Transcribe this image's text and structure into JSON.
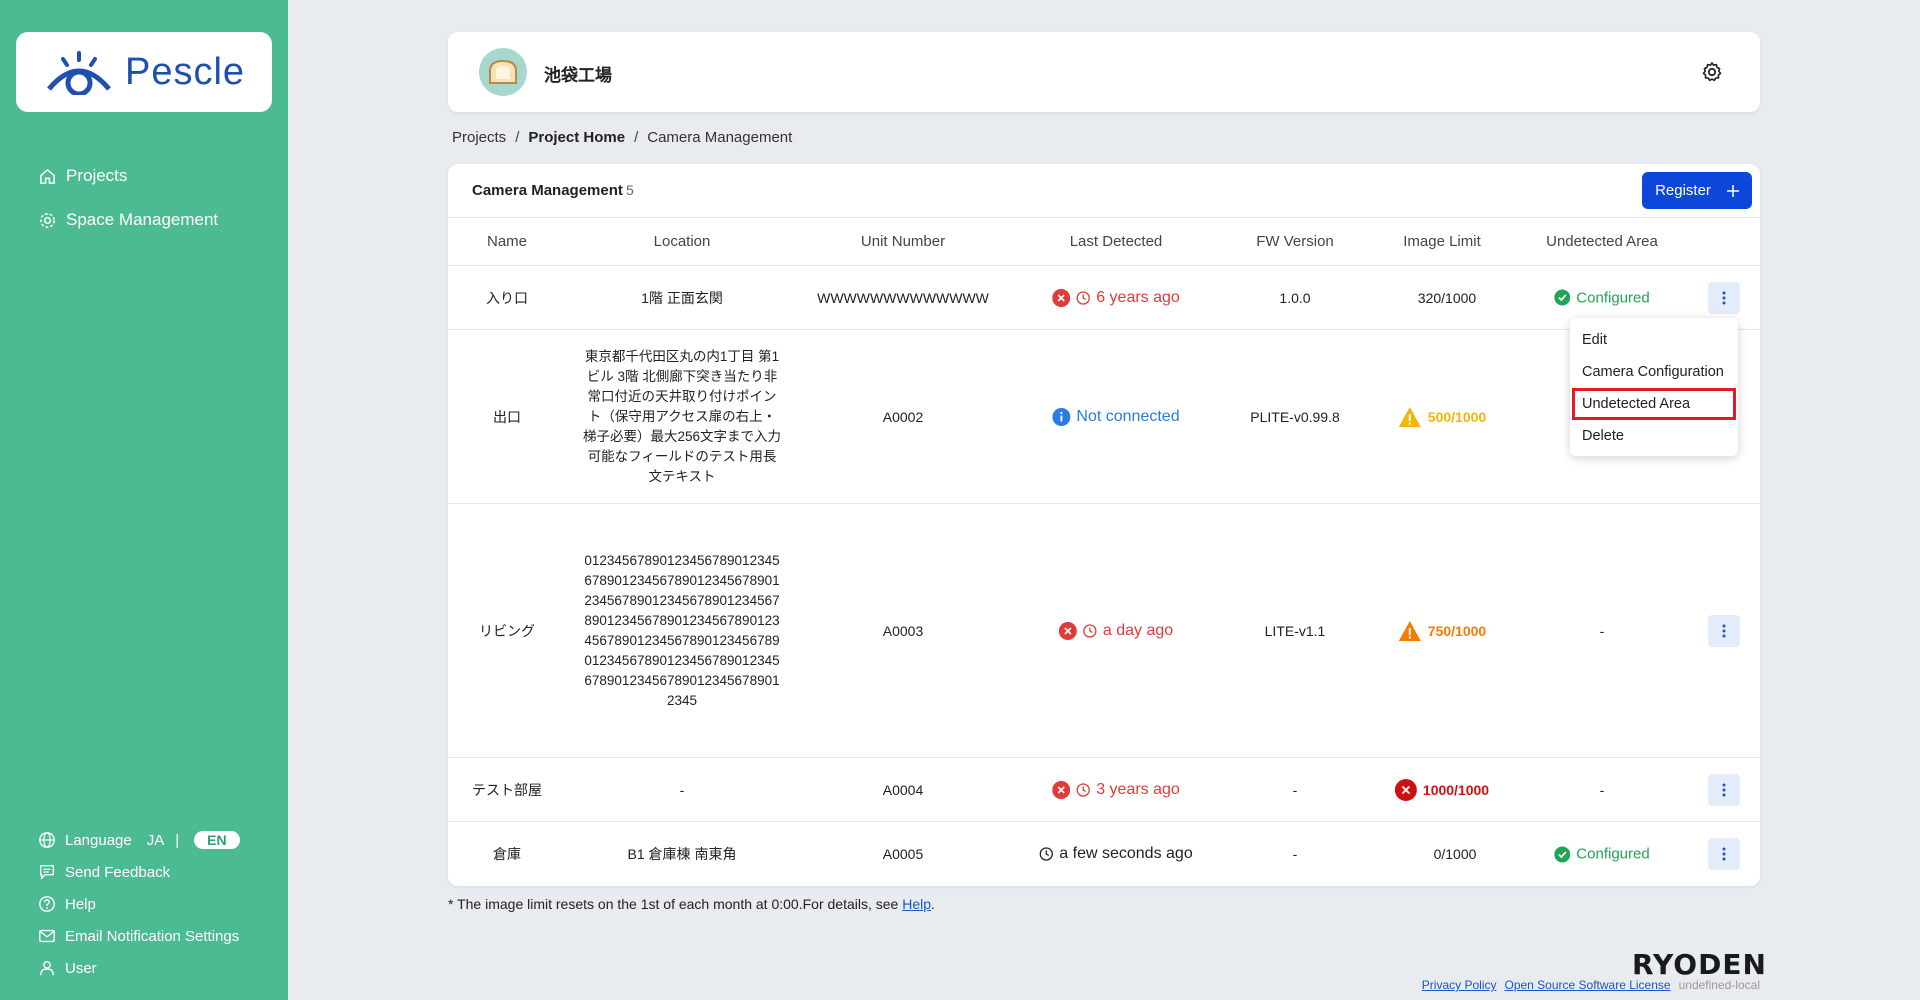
{
  "brand": {
    "logo_text": "Pescle",
    "company": "RYODEN"
  },
  "sidebar": {
    "nav": [
      {
        "label": "Projects",
        "icon": "home-icon"
      },
      {
        "label": "Space Management",
        "icon": "gear-icon"
      }
    ],
    "language": {
      "label": "Language",
      "ja": "JA",
      "separator": "|",
      "en": "EN",
      "selected": "EN"
    },
    "bottom": [
      {
        "label": "Send Feedback",
        "icon": "feedback-icon"
      },
      {
        "label": "Help",
        "icon": "help-icon"
      },
      {
        "label": "Email Notification Settings",
        "icon": "mail-icon"
      },
      {
        "label": "User",
        "icon": "user-icon"
      }
    ]
  },
  "header": {
    "project_name": "池袋工場"
  },
  "breadcrumb": {
    "items": [
      "Projects",
      "Project Home",
      "Camera Management"
    ],
    "separator": "/"
  },
  "card": {
    "title": "Camera Management",
    "count": "5",
    "register_label": "Register"
  },
  "columns": [
    "Name",
    "Location",
    "Unit Number",
    "Last Detected",
    "FW Version",
    "Image Limit",
    "Undetected Area"
  ],
  "rows": [
    {
      "name": "入り口",
      "location": "1階 正面玄関",
      "unit": "WWWWWWWWWWWWW",
      "last_detected": "6 years ago",
      "fw": "1.0.0",
      "limit": "320/1000",
      "undetected": "Configured"
    },
    {
      "name": "出口",
      "location": "東京都千代田区丸の内1丁目 第1ビル 3階 北側廊下突き当たり非常口付近の天井取り付けポイント（保守用アクセス扉の右上・梯子必要）最大256文字まで入力可能なフィールドのテスト用長文テキスト",
      "unit": "A0002",
      "last_detected": "Not connected",
      "fw": "PLITE-v0.99.8",
      "limit": "500/1000",
      "undetected": ""
    },
    {
      "name": "リビング",
      "location": "012345678901234567890123456789012345678901234567890123456789012345678901234567890123456789012345678901234567890123456789012345678901234567890123456789012345678901234567890123456789012345",
      "unit": "A0003",
      "last_detected": "a day ago",
      "fw": "LITE-v1.1",
      "limit": "750/1000",
      "undetected": "-"
    },
    {
      "name": "テスト部屋",
      "location": "-",
      "unit": "A0004",
      "last_detected": "3 years ago",
      "fw": "-",
      "limit": "1000/1000",
      "undetected": "-"
    },
    {
      "name": "倉庫",
      "location": "B1 倉庫棟 南東角",
      "unit": "A0005",
      "last_detected": "a few seconds ago",
      "fw": "-",
      "limit": "0/1000",
      "undetected": "Configured"
    }
  ],
  "menu": {
    "items": [
      "Edit",
      "Camera Configuration",
      "Undetected Area",
      "Delete"
    ],
    "highlighted": "Undetected Area"
  },
  "footnote": {
    "text": "* The image limit resets on the 1st of each month at 0:00.For details, see ",
    "link": "Help",
    "end": "."
  },
  "footer": {
    "privacy": "Privacy Policy",
    "oss": "Open Source Software License",
    "env": "undefined-local"
  },
  "colors": {
    "sidebar": "#4dbb91",
    "primary": "#0d47d9",
    "error": "#e13a3a",
    "warning": "#f57c00",
    "success": "#1fa555"
  }
}
